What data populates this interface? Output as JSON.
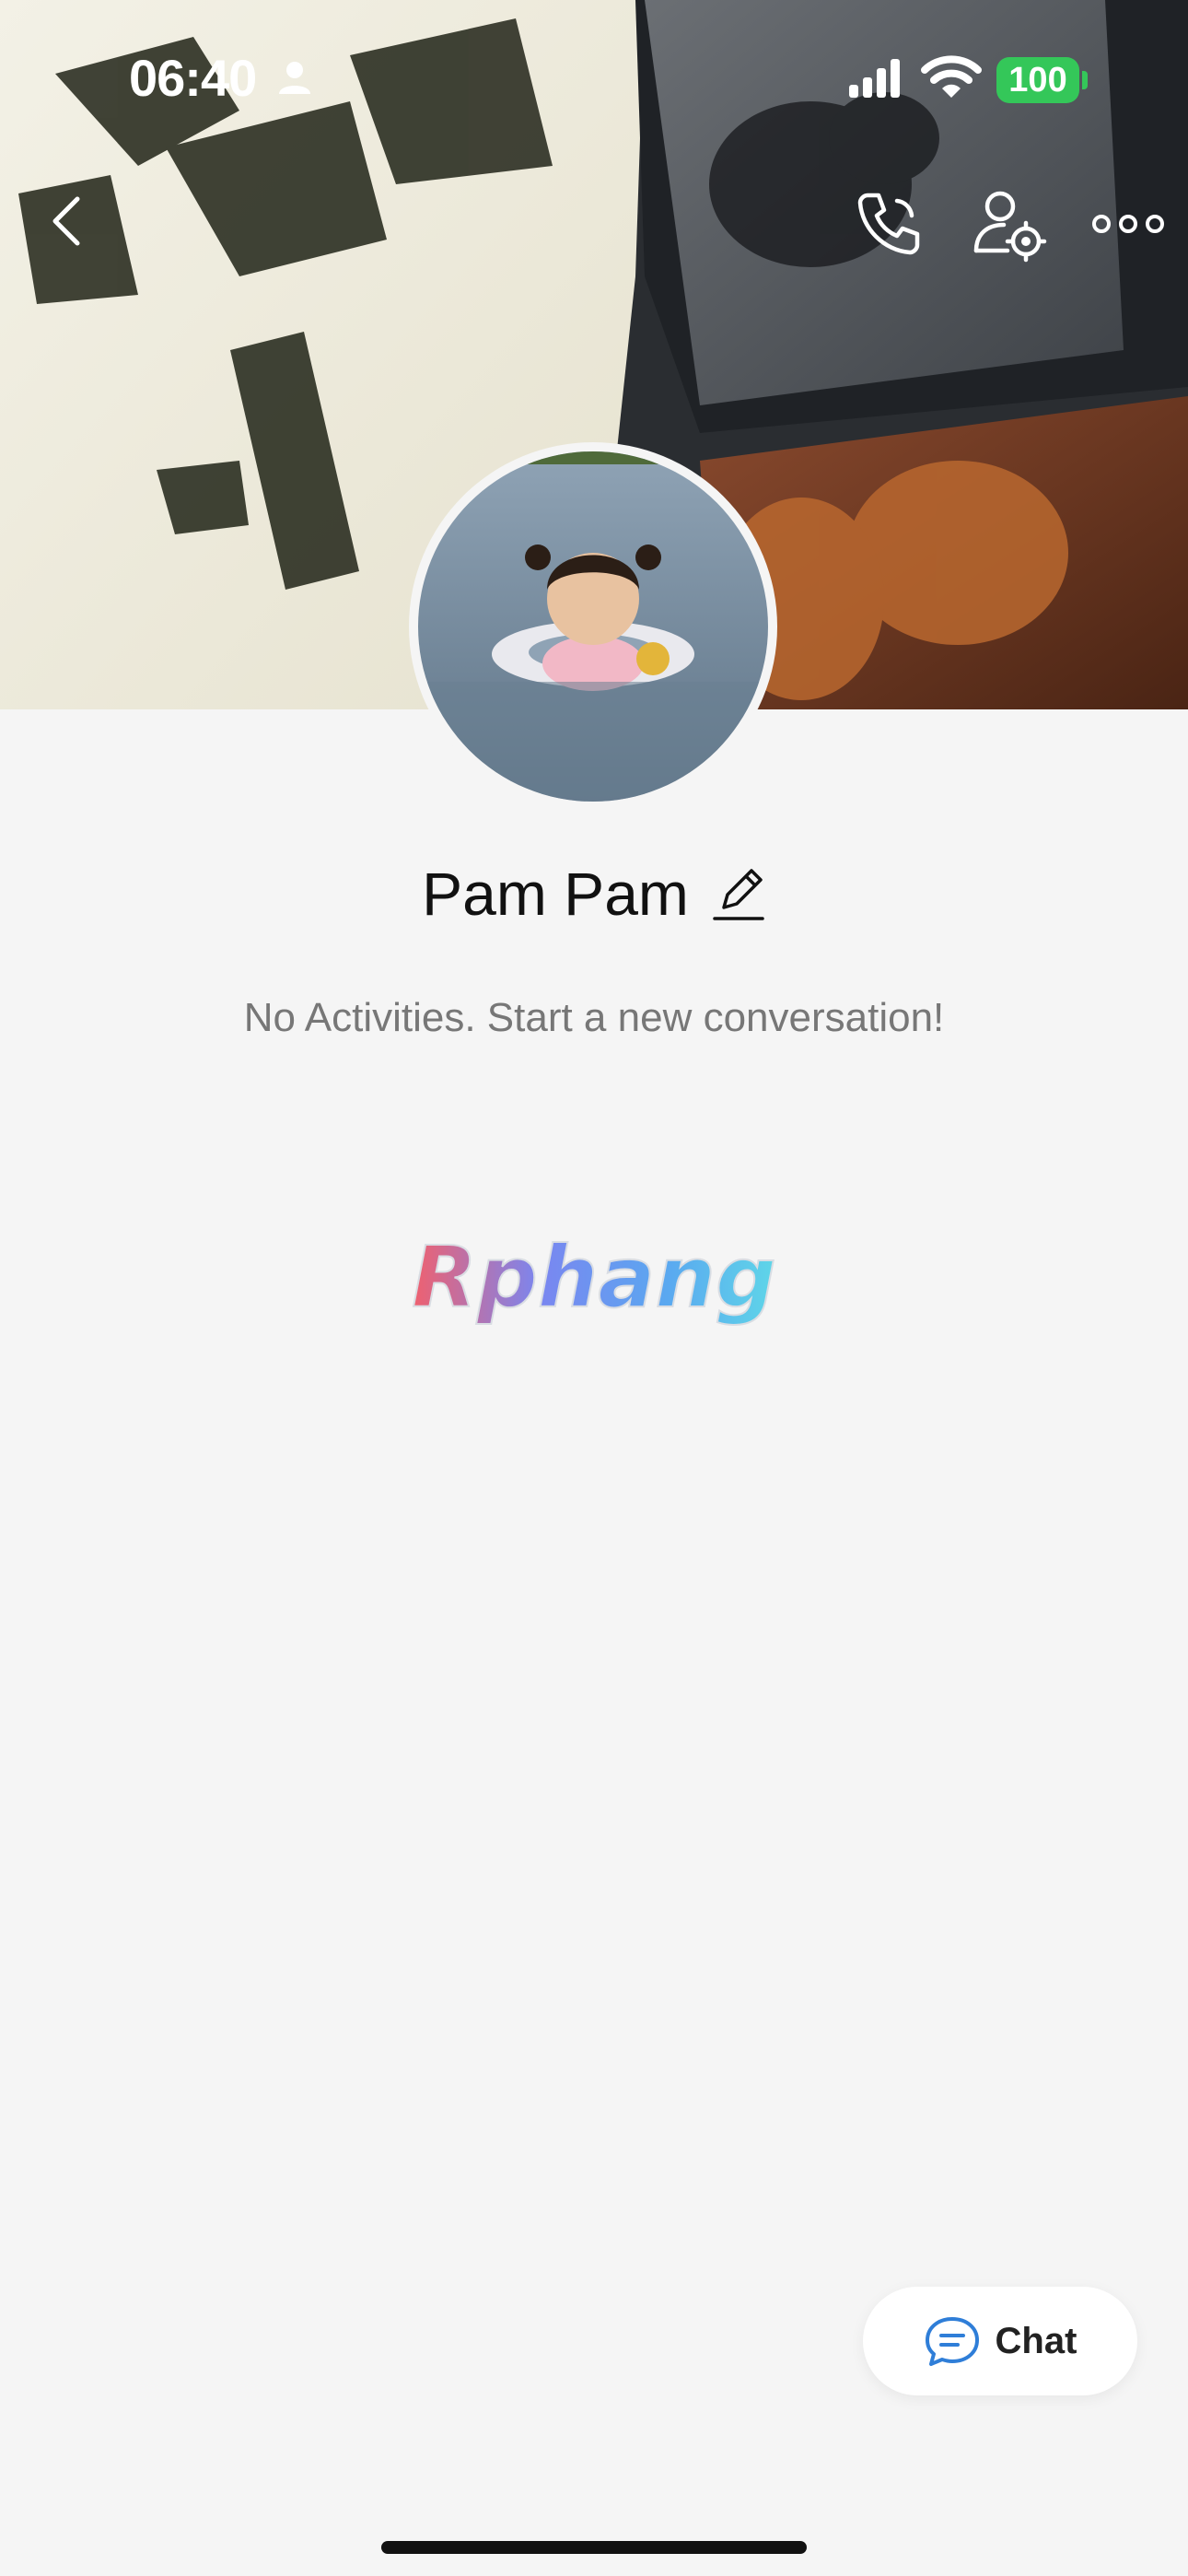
{
  "status_bar": {
    "time": "06:40",
    "battery": "100"
  },
  "profile": {
    "name": "Pam Pam"
  },
  "activity": {
    "empty_message": "No Activities. Start a new conversation!"
  },
  "brand": {
    "logo_text": "Rphang"
  },
  "actions": {
    "chat_label": "Chat"
  },
  "colors": {
    "background": "#f5f5f5",
    "battery_green": "#34c759",
    "chat_icon_blue": "#2f7ed8"
  }
}
